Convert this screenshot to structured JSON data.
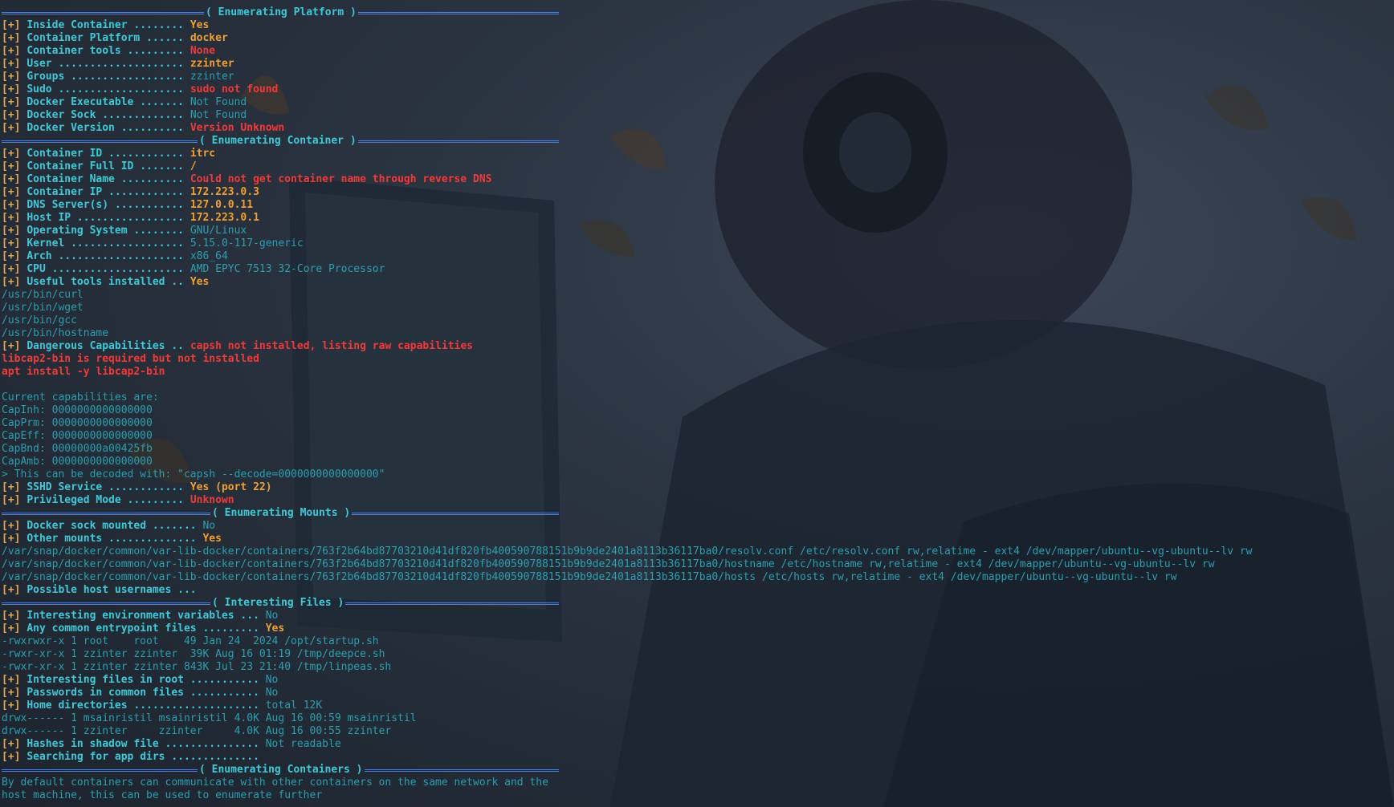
{
  "colors": {
    "accent_blue": "#4a7fe8",
    "teal": "#2fb5c8",
    "orange": "#f0a030",
    "red": "#f03a3a",
    "bg": "#2b3441"
  },
  "tag": "[+]",
  "sections": [
    {
      "title": "( Enumerating Platform )",
      "lines": [
        {
          "label": "Inside Container ........ ",
          "value": "Yes",
          "style": "orange"
        },
        {
          "label": "Container Platform ...... ",
          "value": "docker",
          "style": "orange"
        },
        {
          "label": "Container tools ......... ",
          "value": "None",
          "style": "red"
        },
        {
          "label": "User .................... ",
          "value": "zzinter",
          "style": "orange"
        },
        {
          "label": "Groups .................. ",
          "value": "zzinter",
          "style": "teal"
        },
        {
          "label": "Sudo .................... ",
          "value": "sudo not found",
          "style": "red"
        },
        {
          "label": "Docker Executable ....... ",
          "value": "Not Found",
          "style": "teal"
        },
        {
          "label": "Docker Sock ............. ",
          "value": "Not Found",
          "style": "teal"
        },
        {
          "label": "Docker Version .......... ",
          "value": "Version Unknown",
          "style": "red"
        }
      ]
    },
    {
      "title": "( Enumerating Container )",
      "lines": [
        {
          "label": "Container ID ............ ",
          "value": "itrc",
          "style": "orange"
        },
        {
          "label": "Container Full ID ....... ",
          "value": "/",
          "style": "orange"
        },
        {
          "label": "Container Name .......... ",
          "value": "Could not get container name through reverse DNS",
          "style": "red"
        },
        {
          "label": "Container IP ............ ",
          "value": "172.223.0.3",
          "style": "orange"
        },
        {
          "label": "DNS Server(s) ........... ",
          "value": "127.0.0.11",
          "style": "orange"
        },
        {
          "label": "Host IP ................. ",
          "value": "172.223.0.1",
          "style": "orange"
        },
        {
          "label": "Operating System ........ ",
          "value": "GNU/Linux",
          "style": "teal"
        },
        {
          "label": "Kernel .................. ",
          "value": "5.15.0-117-generic",
          "style": "teal"
        },
        {
          "label": "Arch .................... ",
          "value": "x86_64",
          "style": "teal"
        },
        {
          "label": "CPU ..................... ",
          "value": "AMD EPYC 7513 32-Core Processor",
          "style": "teal"
        },
        {
          "label": "Useful tools installed .. ",
          "value": "Yes",
          "style": "orange"
        },
        {
          "text": "/usr/bin/curl",
          "style": "plain"
        },
        {
          "text": "/usr/bin/wget",
          "style": "plain"
        },
        {
          "text": "/usr/bin/gcc",
          "style": "plain"
        },
        {
          "text": "/usr/bin/hostname",
          "style": "plain"
        },
        {
          "label": "Dangerous Capabilities .. ",
          "value": "capsh not installed, listing raw capabilities",
          "style": "red"
        },
        {
          "text": "libcap2-bin is required but not installed",
          "style": "red"
        },
        {
          "text": "apt install -y libcap2-bin",
          "style": "red"
        },
        {
          "text": "",
          "style": "plain"
        },
        {
          "text": "Current capabilities are:",
          "style": "plain"
        },
        {
          "text": "CapInh: 0000000000000000",
          "style": "plain"
        },
        {
          "text": "CapPrm: 0000000000000000",
          "style": "plain"
        },
        {
          "text": "CapEff: 0000000000000000",
          "style": "plain"
        },
        {
          "text": "CapBnd: 00000000a00425fb",
          "style": "plain"
        },
        {
          "text": "CapAmb: 0000000000000000",
          "style": "plain"
        },
        {
          "text": "> This can be decoded with: \"capsh --decode=0000000000000000\"",
          "style": "plain"
        },
        {
          "label": "SSHD Service ............ ",
          "value": "Yes (port 22)",
          "style": "orange"
        },
        {
          "label": "Privileged Mode ......... ",
          "value": "Unknown",
          "style": "red"
        }
      ]
    },
    {
      "title": "( Enumerating Mounts )",
      "lines": [
        {
          "label": "Docker sock mounted ....... ",
          "value": "No",
          "style": "teal"
        },
        {
          "label": "Other mounts .............. ",
          "value": "Yes",
          "style": "orange"
        },
        {
          "text": "/var/snap/docker/common/var-lib-docker/containers/763f2b64bd87703210d41df820fb400590788151b9b9de2401a8113b36117ba0/resolv.conf /etc/resolv.conf rw,relatime - ext4 /dev/mapper/ubuntu--vg-ubuntu--lv rw",
          "style": "plain"
        },
        {
          "text": "/var/snap/docker/common/var-lib-docker/containers/763f2b64bd87703210d41df820fb400590788151b9b9de2401a8113b36117ba0/hostname /etc/hostname rw,relatime - ext4 /dev/mapper/ubuntu--vg-ubuntu--lv rw",
          "style": "plain"
        },
        {
          "text": "/var/snap/docker/common/var-lib-docker/containers/763f2b64bd87703210d41df820fb400590788151b9b9de2401a8113b36117ba0/hosts /etc/hosts rw,relatime - ext4 /dev/mapper/ubuntu--vg-ubuntu--lv rw",
          "style": "plain"
        },
        {
          "label": "Possible host usernames ... ",
          "value": "",
          "style": "teal"
        }
      ]
    },
    {
      "title": "( Interesting Files )",
      "lines": [
        {
          "label": "Interesting environment variables ... ",
          "value": "No",
          "style": "teal"
        },
        {
          "label": "Any common entrypoint files ......... ",
          "value": "Yes",
          "style": "orange"
        },
        {
          "text": "-rwxrwxr-x 1 root    root    49 Jan 24  2024 /opt/startup.sh",
          "style": "plain"
        },
        {
          "text": "-rwxr-xr-x 1 zzinter zzinter  39K Aug 16 01:19 /tmp/deepce.sh",
          "style": "plain"
        },
        {
          "text": "-rwxr-xr-x 1 zzinter zzinter 843K Jul 23 21:40 /tmp/linpeas.sh",
          "style": "plain"
        },
        {
          "label": "Interesting files in root ........... ",
          "value": "No",
          "style": "teal"
        },
        {
          "label": "Passwords in common files ........... ",
          "value": "No",
          "style": "teal"
        },
        {
          "label": "Home directories .................... ",
          "value": "total 12K",
          "style": "teal"
        },
        {
          "text": "drwx------ 1 msainristil msainristil 4.0K Aug 16 00:59 msainristil",
          "style": "plain"
        },
        {
          "text": "drwx------ 1 zzinter     zzinter     4.0K Aug 16 00:55 zzinter",
          "style": "plain"
        },
        {
          "label": "Hashes in shadow file ............... ",
          "value": "Not readable",
          "style": "teal"
        },
        {
          "label": "Searching for app dirs .............. ",
          "value": "",
          "style": "teal"
        }
      ]
    },
    {
      "title": "( Enumerating Containers )",
      "lines": [
        {
          "text": "By default containers can communicate with other containers on the same network and the",
          "style": "plain"
        },
        {
          "text": "host machine, this can be used to enumerate further",
          "style": "plain"
        }
      ]
    }
  ]
}
